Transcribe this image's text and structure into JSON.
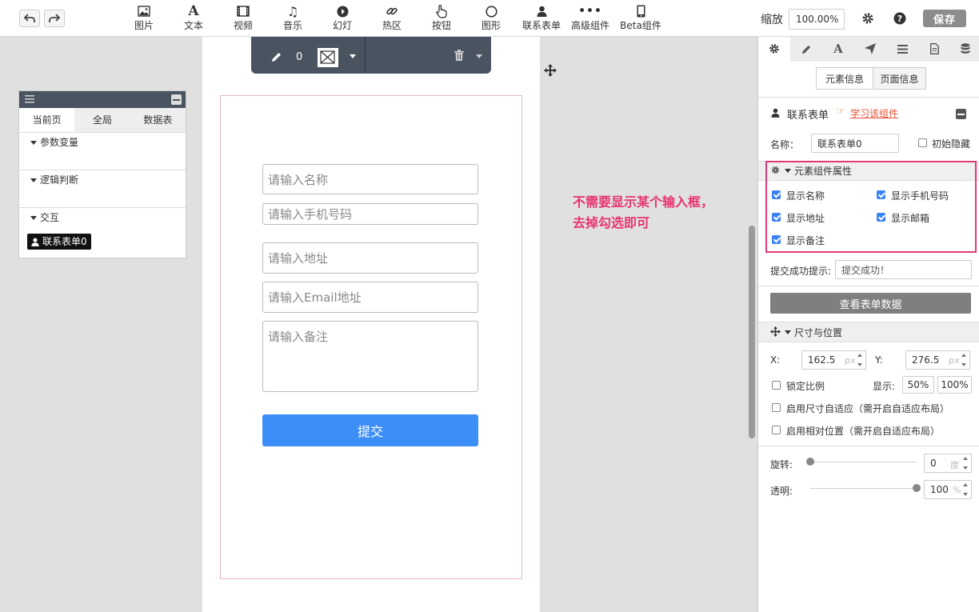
{
  "toolbar": {
    "tools": [
      {
        "label": "图片",
        "icon": "image-icon"
      },
      {
        "label": "文本",
        "icon": "text-icon"
      },
      {
        "label": "视频",
        "icon": "video-icon"
      },
      {
        "label": "音乐",
        "icon": "music-icon"
      },
      {
        "label": "幻灯",
        "icon": "slideshow-icon"
      },
      {
        "label": "热区",
        "icon": "link-icon"
      },
      {
        "label": "按钮",
        "icon": "hand-pointer-icon"
      },
      {
        "label": "图形",
        "icon": "circle-icon"
      },
      {
        "label": "联系表单",
        "icon": "user-icon"
      },
      {
        "label": "高级组件",
        "icon": "more-icon"
      },
      {
        "label": "Beta组件",
        "icon": "device-icon"
      }
    ],
    "zoom_label": "缩放",
    "zoom_value": "100.00%",
    "save_label": "保存"
  },
  "layers": {
    "tabs": [
      "当前页",
      "全局",
      "数据表"
    ],
    "sections": [
      "参数变量",
      "逻辑判断",
      "交互"
    ],
    "item": "联系表单0"
  },
  "float_toolbar": {
    "count": "0"
  },
  "form": {
    "name_placeholder": "请输入名称",
    "phone_placeholder": "请输入手机号码",
    "address_placeholder": "请输入地址",
    "email_placeholder": "请输入Email地址",
    "note_placeholder": "请输入备注",
    "submit_label": "提交"
  },
  "annotation": {
    "line1": "不需要显示某个输入框，",
    "line2": "去掉勾选即可"
  },
  "panel": {
    "tabs": [
      "gear-icon",
      "pencil-icon",
      "font-icon",
      "send-icon",
      "list-icon",
      "document-icon",
      "database-icon"
    ],
    "element_info": "元素信息",
    "page_info": "页面信息",
    "component_title": "联系表单",
    "learn_link": "学习该组件",
    "name_label": "名称：",
    "name_value": "联系表单0",
    "init_hidden": "初始隐藏",
    "props_title": "元素组件属性",
    "options": [
      {
        "label": "显示名称",
        "checked": true
      },
      {
        "label": "显示手机号码",
        "checked": true
      },
      {
        "label": "显示地址",
        "checked": true
      },
      {
        "label": "显示邮箱",
        "checked": true
      },
      {
        "label": "显示备注",
        "checked": true
      }
    ],
    "success_label": "提交成功提示:",
    "success_value": "提交成功！",
    "view_data_btn": "查看表单数据",
    "size_title": "尺寸与位置",
    "x_label": "X:",
    "x_value": "162.5",
    "y_label": "Y:",
    "y_value": "276.5",
    "px": "px",
    "lock_ratio": "锁定比例",
    "display_label": "显示:",
    "display_50": "50%",
    "display_100": "100%",
    "adaptive_size": "启用尺寸自适应（需开启自适应布局）",
    "relative_pos": "启用相对位置（需开启自适应布局）",
    "rotate_label": "旋转:",
    "rotate_value": "0",
    "rotate_unit": "度",
    "rotate_level": 0,
    "opacity_label": "透明:",
    "opacity_value": "100",
    "opacity_unit": "%",
    "opacity_level": 1.0
  }
}
